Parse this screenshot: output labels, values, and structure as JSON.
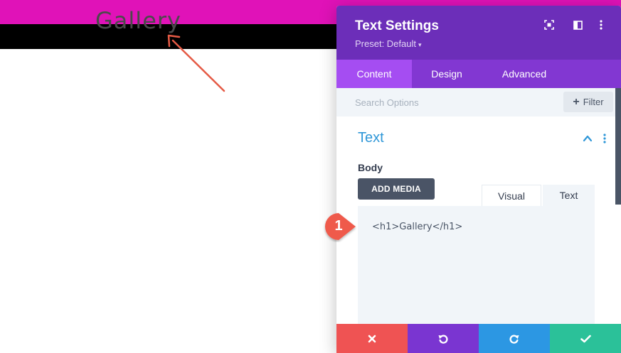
{
  "page": {
    "heading": "Gallery",
    "colors": {
      "top_bar": "#e012b8",
      "menu_bar": "#000000",
      "arrow": "#e55a45"
    }
  },
  "panel": {
    "title": "Text Settings",
    "preset": "Preset: Default",
    "header_icons": [
      "fullscreen-icon",
      "sidebar-columns-icon",
      "more-vertical-icon"
    ],
    "tabs": [
      {
        "label": "Content",
        "active": true
      },
      {
        "label": "Design",
        "active": false
      },
      {
        "label": "Advanced",
        "active": false
      }
    ],
    "search": {
      "placeholder": "Search Options",
      "filter_label": "Filter"
    },
    "section": {
      "title": "Text",
      "field_label": "Body",
      "add_media_label": "ADD MEDIA",
      "editor_tabs": [
        "Visual",
        "Text"
      ],
      "editor_content": "<h1>Gallery</h1>"
    },
    "footer_icons": [
      "close-icon",
      "undo-icon",
      "redo-icon",
      "check-icon"
    ],
    "colors": {
      "header": "#6c2eb9",
      "tabs": "#8237d2",
      "active_tab": "#a54df2",
      "section_title": "#2f97d8",
      "cancel": "#ef5353",
      "undo": "#7a35d1",
      "redo": "#2c97e3",
      "save": "#2bc199"
    }
  },
  "badge": {
    "number": "1",
    "color": "#ef5a4c"
  }
}
